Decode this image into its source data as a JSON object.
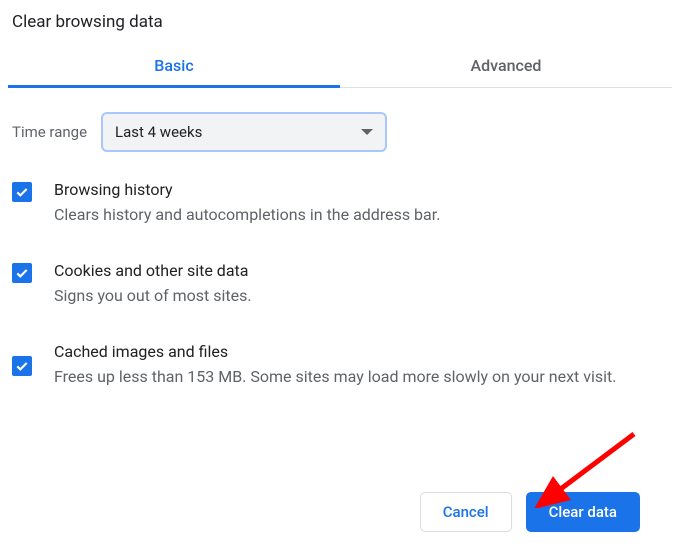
{
  "title": "Clear browsing data",
  "tabs": {
    "basic": "Basic",
    "advanced": "Advanced"
  },
  "time": {
    "label": "Time range",
    "value": "Last 4 weeks"
  },
  "options": [
    {
      "title": "Browsing history",
      "desc": "Clears history and autocompletions in the address bar."
    },
    {
      "title": "Cookies and other site data",
      "desc": "Signs you out of most sites."
    },
    {
      "title": "Cached images and files",
      "desc": "Frees up less than 153 MB. Some sites may load more slowly on your next visit."
    }
  ],
  "buttons": {
    "cancel": "Cancel",
    "clear": "Clear data"
  }
}
